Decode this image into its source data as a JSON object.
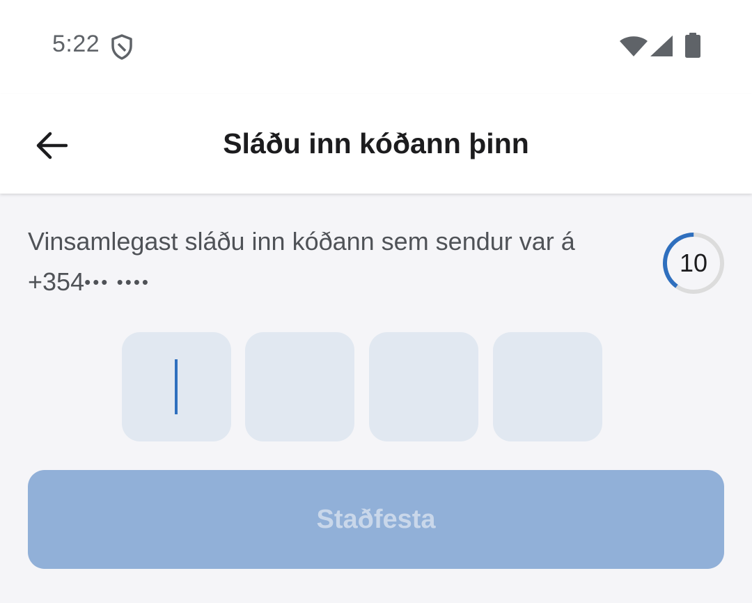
{
  "status_bar": {
    "time": "5:22",
    "icons": [
      "shield-icon",
      "wifi-icon",
      "signal-icon",
      "battery-icon"
    ]
  },
  "header": {
    "title": "Sláðu inn kóðann þinn",
    "back_icon": "arrow-left-icon"
  },
  "main": {
    "instruction": "Vinsamlegast sláðu inn kóðann sem sendur var á",
    "phone_prefix": "+354",
    "phone_masked": "•••  ••••",
    "timer": {
      "value": "10",
      "progress_fraction": 0.4,
      "progress_color": "#2f6fbe",
      "track_color": "#dcdcdc"
    },
    "code_fields": [
      {
        "value": "",
        "focused": true
      },
      {
        "value": "",
        "focused": false
      },
      {
        "value": "",
        "focused": false
      },
      {
        "value": "",
        "focused": false
      }
    ],
    "confirm_button": "Staðfesta"
  },
  "colors": {
    "accent": "#2f6fbe",
    "button_disabled": "#91b0d8",
    "code_field": "#e1e8f1",
    "background": "#f5f5f8"
  }
}
